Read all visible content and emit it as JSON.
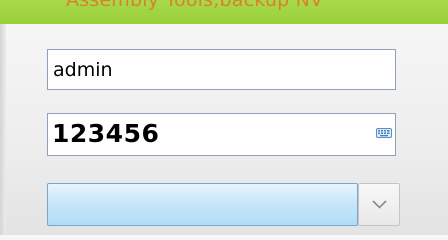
{
  "window": {
    "title": "Assembly Tools,backup NV"
  },
  "login": {
    "username_value": "admin",
    "password_value": "123456",
    "selected_option": ""
  },
  "icons": {
    "keyboard": "keyboard-icon",
    "dropdown": "chevron-down-icon"
  },
  "colors": {
    "title_bar": "#9ad03a",
    "title_text": "#d9822b",
    "field_border": "#8ea1b5",
    "select_fill": "#c9e7fa"
  }
}
